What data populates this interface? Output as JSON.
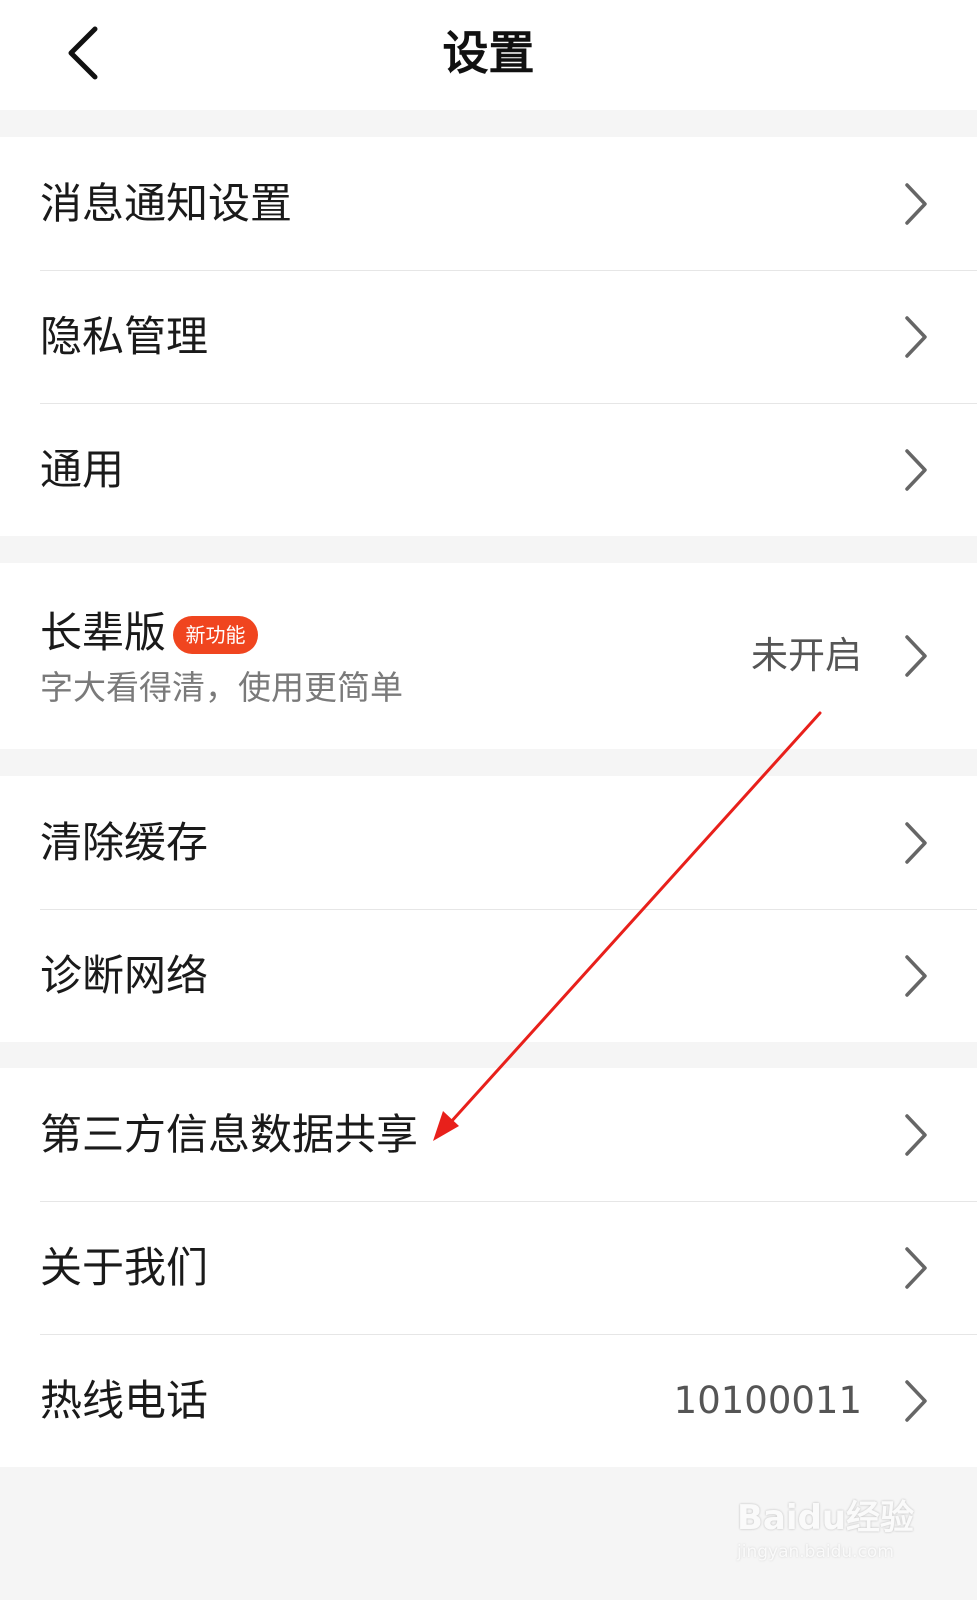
{
  "header": {
    "title": "设置",
    "back_icon": "back-arrow-icon"
  },
  "groups": [
    {
      "items": [
        {
          "label": "消息通知设置",
          "icon": "chevron-right-icon"
        },
        {
          "label": "隐私管理",
          "icon": "chevron-right-icon"
        },
        {
          "label": "通用",
          "icon": "chevron-right-icon"
        }
      ]
    },
    {
      "items": [
        {
          "label": "长辈版",
          "badge": "新功能",
          "subtitle": "字大看得清，使用更简单",
          "value": "未开启",
          "icon": "chevron-right-icon"
        }
      ]
    },
    {
      "items": [
        {
          "label": "清除缓存",
          "icon": "chevron-right-icon"
        },
        {
          "label": "诊断网络",
          "icon": "chevron-right-icon"
        }
      ]
    },
    {
      "items": [
        {
          "label": "第三方信息数据共享",
          "icon": "chevron-right-icon"
        },
        {
          "label": "关于我们",
          "icon": "chevron-right-icon"
        },
        {
          "label": "热线电话",
          "value": "10100011",
          "icon": "chevron-right-icon"
        }
      ]
    }
  ],
  "annotation": {
    "icon": "red-arrow-icon",
    "color": "#e8201b"
  },
  "watermark": {
    "logo": "Baidu经验",
    "url": "jingyan.baidu.com"
  },
  "colors": {
    "badge": "#f0451f",
    "background": "#f5f5f5"
  }
}
